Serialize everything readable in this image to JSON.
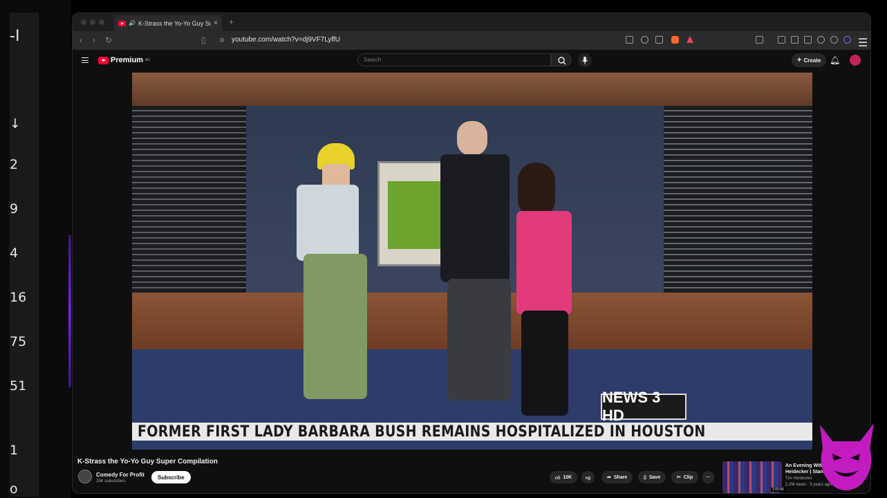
{
  "left_app": {
    "numbers": [
      "-I",
      "↓",
      "2",
      "9",
      "4",
      "16",
      "75",
      "51",
      "1",
      "o"
    ]
  },
  "browser": {
    "tab_title": "K-Strass the Yo-Yo Guy Su",
    "tab_close": "×",
    "new_tab": "+",
    "url": "youtube.com/watch?v=dj9VF7LyffU"
  },
  "youtube": {
    "brand": "Premium",
    "brand_region": "AU",
    "search_placeholder": "Search",
    "create_label": "Create",
    "video": {
      "ticker": "FORMER FIRST LADY BARBARA BUSH REMAINS HOSPITALIZED IN HOUSTON",
      "bug": "NEWS 3 HD",
      "title": "K-Strass the Yo-Yo Guy Super Compilation"
    },
    "channel": {
      "name": "Comedy For Profit",
      "subscribers": "25K subscribers",
      "subscribe_label": "Subscribe"
    },
    "actions": {
      "likes": "10K",
      "share": "Share",
      "save": "Save",
      "clip": "Clip",
      "more": "···"
    },
    "recommendation": {
      "title": "An Evening With Tim Heidecker | Stand-Up Special",
      "channel": "Tim Heidecker",
      "meta": "2.2M views · 5 years ago",
      "duration": "1:00:40"
    }
  },
  "colors": {
    "yt_red": "#ff0033",
    "bg": "#0f0f0f",
    "mascot": "#c21cc0"
  }
}
